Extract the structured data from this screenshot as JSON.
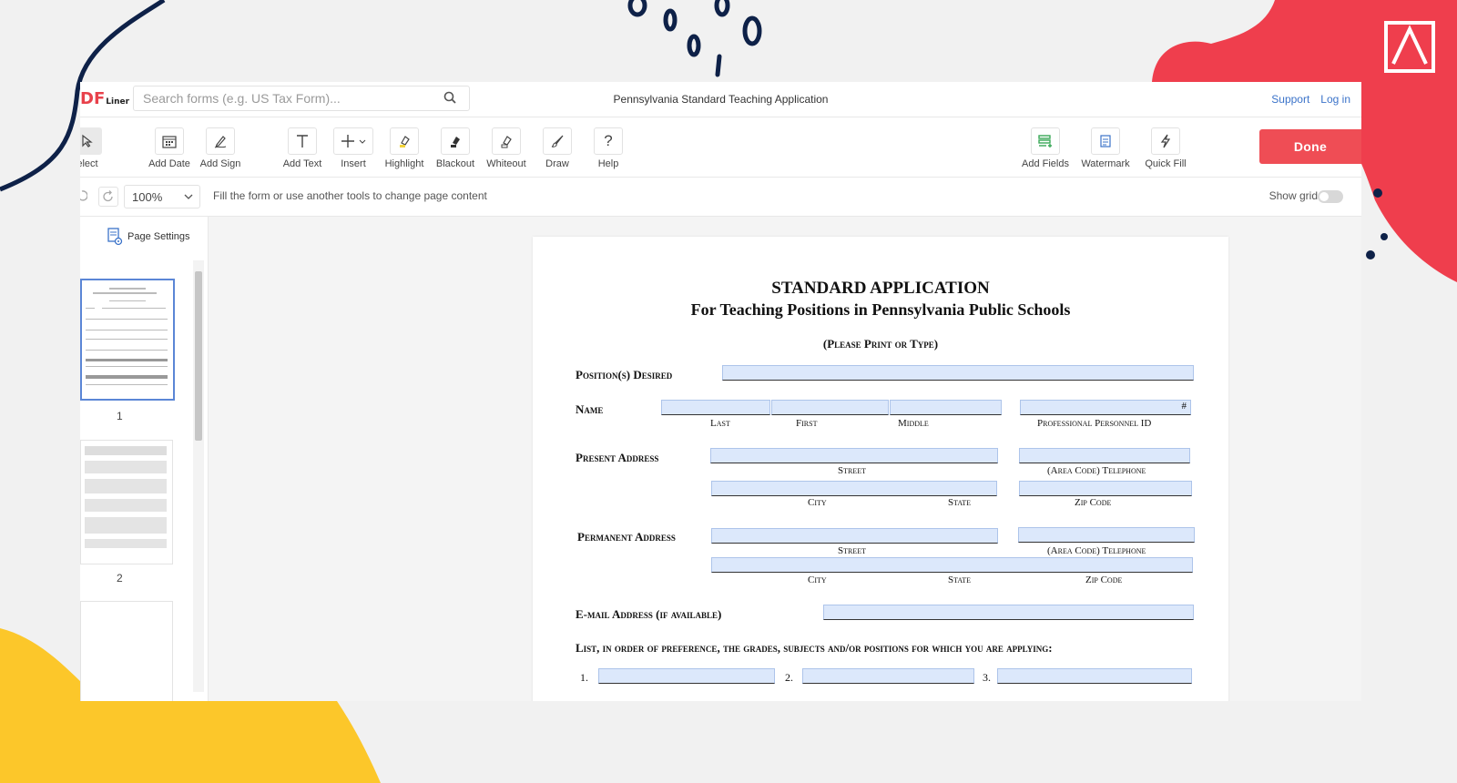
{
  "header": {
    "logo_main": "DF",
    "logo_small": "Liner",
    "search_placeholder": "Search forms (e.g. US Tax Form)...",
    "document_title": "Pennsylvania Standard Teaching Application",
    "support": "Support",
    "login": "Log in"
  },
  "toolbar": {
    "select": "elect",
    "add_date": "Add Date",
    "add_sign": "Add Sign",
    "add_text": "Add Text",
    "insert": "Insert",
    "highlight": "Highlight",
    "blackout": "Blackout",
    "whiteout": "Whiteout",
    "draw": "Draw",
    "help": "Help",
    "add_fields": "Add Fields",
    "watermark": "Watermark",
    "quick_fill": "Quick Fill",
    "done": "Done"
  },
  "subbar": {
    "zoom": "100%",
    "hint": "Fill the form or use another tools to change page content",
    "show_grid": "Show grid",
    "show_grid_on": false
  },
  "sidebar": {
    "page_settings": "Page Settings",
    "pages": [
      "1",
      "2"
    ]
  },
  "form": {
    "title": "STANDARD APPLICATION",
    "subtitle": "For Teaching Positions in Pennsylvania Public Schools",
    "instruction": "(Please Print or Type)",
    "positions_desired": "Position(s) Desired",
    "name": "Name",
    "last": "Last",
    "first": "First",
    "middle": "Middle",
    "hash": "#",
    "personnel_id": "Professional Personnel ID",
    "present_address": "Present Address",
    "permanent_address": "Permanent Address",
    "street": "Street",
    "telephone": "(Area Code) Telephone",
    "city": "City",
    "state": "State",
    "zip": "Zip Code",
    "email": "E-mail Address (if available)",
    "list_prompt": "List, in order of preference, the grades, subjects and/or positions for which you are applying:",
    "n1": "1.",
    "n2": "2.",
    "n3": "3."
  },
  "colors": {
    "accent": "#ef4d55",
    "link": "#3b73c9",
    "field_fill": "#dce8fb",
    "deco_yellow": "#fcc72a",
    "deco_navy": "#0e2148"
  }
}
